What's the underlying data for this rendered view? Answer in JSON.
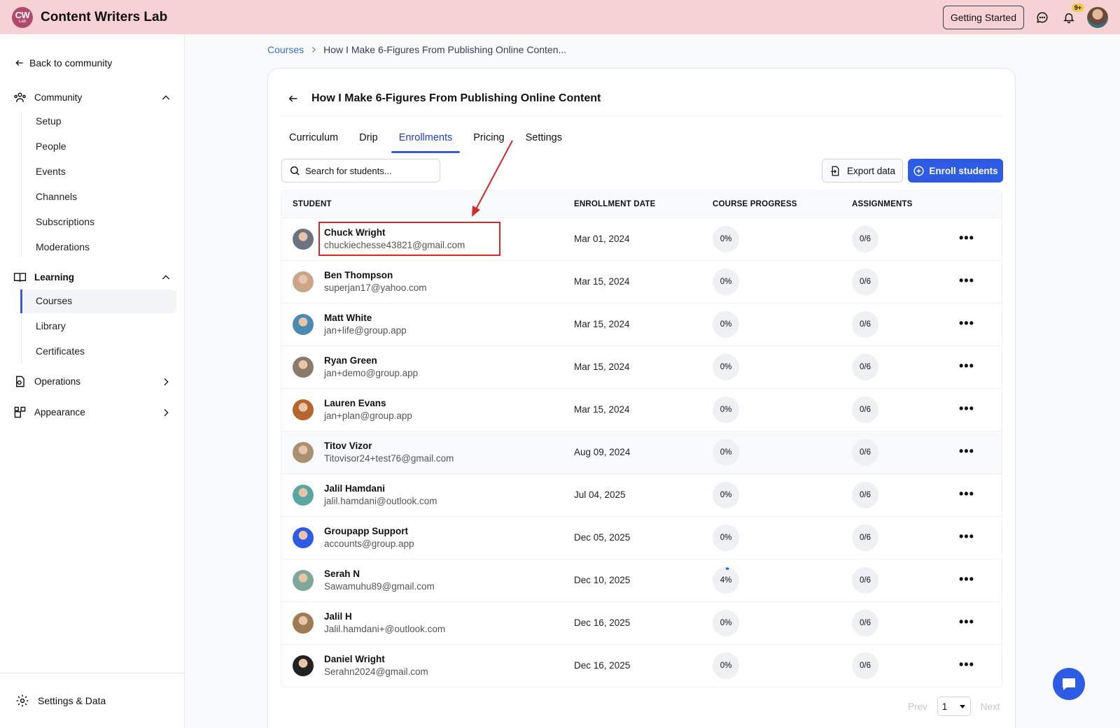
{
  "app": {
    "logo_text": "CW",
    "logo_sub": "Lab",
    "title": "Content Writers Lab"
  },
  "header": {
    "getting_started": "Getting Started",
    "notifications_badge": "9+"
  },
  "sidebar": {
    "back": "Back to community",
    "community": {
      "label": "Community",
      "items": [
        "Setup",
        "People",
        "Events",
        "Channels",
        "Subscriptions",
        "Moderations"
      ]
    },
    "learning": {
      "label": "Learning",
      "items": [
        "Courses",
        "Library",
        "Certificates"
      ],
      "active": "Courses"
    },
    "operations": "Operations",
    "appearance": "Appearance",
    "footer": "Settings & Data"
  },
  "breadcrumb": {
    "root": "Courses",
    "current": "How I Make 6-Figures From Publishing Online Conten..."
  },
  "course": {
    "title": "How I Make 6-Figures From Publishing Online Content"
  },
  "tabs": [
    "Curriculum",
    "Drip",
    "Enrollments",
    "Pricing",
    "Settings"
  ],
  "active_tab": "Enrollments",
  "toolbar": {
    "search_placeholder": "Search for students...",
    "export": "Export data",
    "enroll": "Enroll students"
  },
  "table": {
    "headers": {
      "student": "STUDENT",
      "date": "ENROLLMENT DATE",
      "progress": "COURSE PROGRESS",
      "assignments": "ASSIGNMENTS"
    },
    "rows": [
      {
        "name": "Chuck Wright",
        "email": "chuckiechesse43821@gmail.com",
        "date": "Mar 01, 2024",
        "progress": "0%",
        "progress_fraction": 0,
        "assignments": "0/6",
        "highlighted": true,
        "avatar_color": "#6b7280"
      },
      {
        "name": "Ben Thompson",
        "email": "superjan17@yahoo.com",
        "date": "Mar 15, 2024",
        "progress": "0%",
        "progress_fraction": 0,
        "assignments": "0/6",
        "avatar_color": "#c9a58a"
      },
      {
        "name": "Matt White",
        "email": "jan+life@group.app",
        "date": "Mar 15, 2024",
        "progress": "0%",
        "progress_fraction": 0,
        "assignments": "0/6",
        "avatar_color": "#4b8bb3"
      },
      {
        "name": "Ryan Green",
        "email": "jan+demo@group.app",
        "date": "Mar 15, 2024",
        "progress": "0%",
        "progress_fraction": 0,
        "assignments": "0/6",
        "avatar_color": "#8a7a6a"
      },
      {
        "name": "Lauren Evans",
        "email": "jan+plan@group.app",
        "date": "Mar 15, 2024",
        "progress": "0%",
        "progress_fraction": 0,
        "assignments": "0/6",
        "avatar_color": "#b5652e"
      },
      {
        "name": "Titov Vizor",
        "email": "Titovisor24+test76@gmail.com",
        "date": "Aug 09, 2024",
        "progress": "0%",
        "progress_fraction": 0,
        "assignments": "0/6",
        "hover": true,
        "avatar_color": "#a89070"
      },
      {
        "name": "Jalil Hamdani",
        "email": "jalil.hamdani@outlook.com",
        "date": "Jul 04, 2025",
        "progress": "0%",
        "progress_fraction": 0,
        "assignments": "0/6",
        "avatar_color": "#5aa7a2"
      },
      {
        "name": "Groupapp Support",
        "email": "accounts@group.app",
        "date": "Dec 05, 2025",
        "progress": "0%",
        "progress_fraction": 0,
        "assignments": "0/6",
        "avatar_color": "#2d5be3"
      },
      {
        "name": "Serah N",
        "email": "Sawamuhu89@gmail.com",
        "date": "Dec 10, 2025",
        "progress": "4%",
        "progress_fraction": 0.04,
        "assignments": "0/6",
        "avatar_color": "#7fa89a"
      },
      {
        "name": "Jalil H",
        "email": "Jalil.hamdani+@outlook.com",
        "date": "Dec 16, 2025",
        "progress": "0%",
        "progress_fraction": 0,
        "assignments": "0/6",
        "avatar_color": "#9c7b55"
      },
      {
        "name": "Daniel Wright",
        "email": "Serahn2024@gmail.com",
        "date": "Dec 16, 2025",
        "progress": "0%",
        "progress_fraction": 0,
        "assignments": "0/6",
        "avatar_color": "#222222"
      }
    ]
  },
  "pager": {
    "prev": "Prev",
    "page": "1",
    "next": "Next"
  },
  "colors": {
    "accent": "#2d5be3",
    "topbar": "#f6d2d4",
    "annotation": "#d62828"
  }
}
